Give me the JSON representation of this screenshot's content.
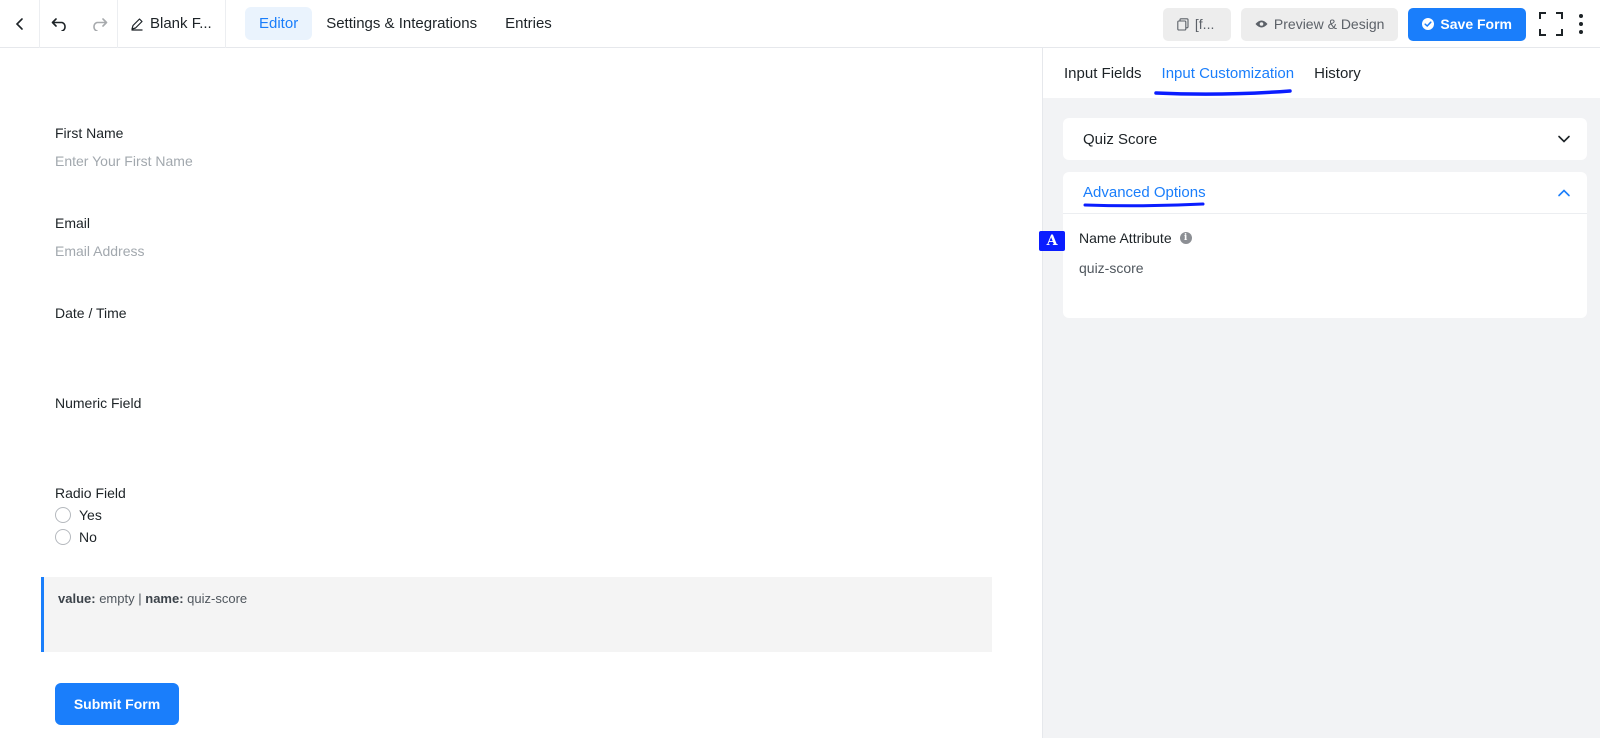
{
  "topbar": {
    "back_icon": "chevron-left-icon",
    "undo_icon": "undo-icon",
    "redo_icon": "redo-icon",
    "form_title": "Blank F...",
    "nav_tabs": [
      {
        "label": "Editor",
        "active": true
      },
      {
        "label": "Settings & Integrations",
        "active": false
      },
      {
        "label": "Entries",
        "active": false
      }
    ],
    "shortcode_label": "[f...",
    "preview_label": "Preview & Design",
    "save_label": "Save Form",
    "accent_color": "#1a7efb"
  },
  "form": {
    "fields": [
      {
        "label": "First Name",
        "placeholder": "Enter Your First Name"
      },
      {
        "label": "Email",
        "placeholder": "Email Address"
      },
      {
        "label": "Date / Time",
        "placeholder": ""
      },
      {
        "label": "Numeric Field",
        "placeholder": ""
      }
    ],
    "radio": {
      "label": "Radio Field",
      "options": [
        "Yes",
        "No"
      ]
    },
    "debug": {
      "value_key": "value:",
      "value_text": "empty",
      "separator": "|",
      "name_key": "name:",
      "name_text": "quiz-score"
    },
    "submit_label": "Submit Form"
  },
  "sidebar": {
    "tabs": [
      {
        "label": "Input Fields",
        "active": false
      },
      {
        "label": "Input Customization",
        "active": true
      },
      {
        "label": "History",
        "active": false
      }
    ],
    "quiz_panel_title": "Quiz Score",
    "advanced_title": "Advanced Options",
    "name_attribute_label": "Name Attribute",
    "name_attribute_value": "quiz-score",
    "marker_label": "A",
    "annotation_color": "#0a1dff"
  }
}
